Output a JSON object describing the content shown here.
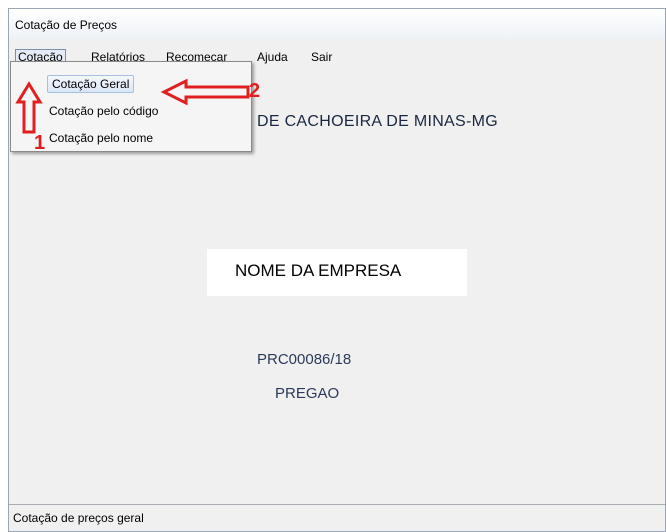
{
  "window": {
    "title": "Cotação de Preços"
  },
  "menubar": {
    "items": [
      "Cotação",
      "Relatórios",
      "Recomeçar",
      "Ajuda",
      "Sair"
    ]
  },
  "dropdown": {
    "items": [
      "Cotação Geral",
      "Cotação pelo código",
      "Cotação pelo nome"
    ]
  },
  "main": {
    "heading": "DE CACHOEIRA DE MINAS-MG",
    "company_name": "NOME DA EMPRESA",
    "process_code": "PRC00086/18",
    "modality": "PREGAO"
  },
  "annotations": {
    "step1": "1",
    "step2": "2",
    "color": "#e02020"
  },
  "statusbar": {
    "text": "Cotação de preços geral"
  }
}
